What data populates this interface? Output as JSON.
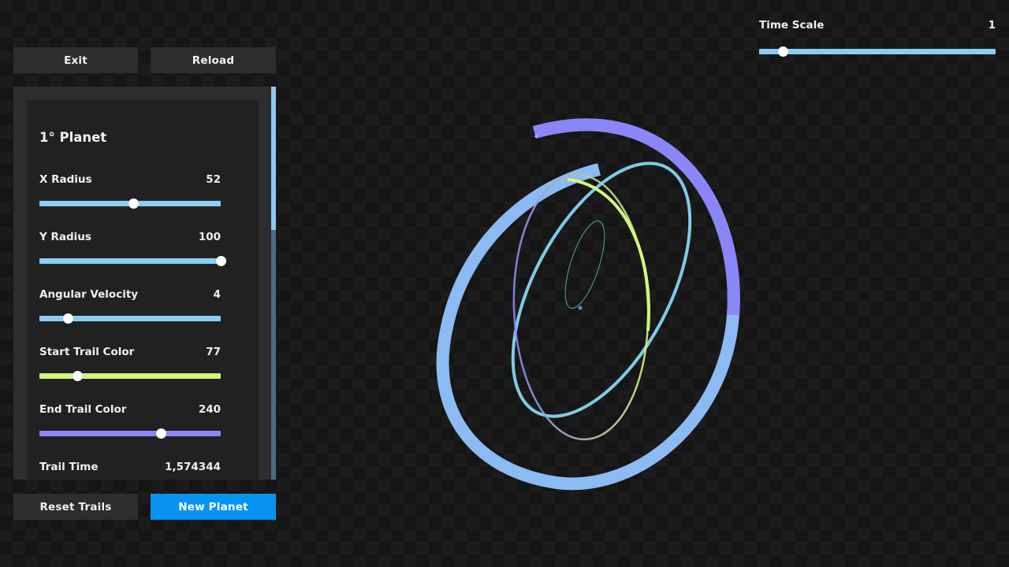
{
  "buttons": {
    "exit": "Exit",
    "reload": "Reload",
    "reset_trails": "Reset Trails",
    "new_planet": "New Planet"
  },
  "panel": {
    "title": "1° Planet",
    "fields": [
      {
        "label": "X Radius",
        "value": "52",
        "level": 0.52,
        "color": "#8ccdf5"
      },
      {
        "label": "Y Radius",
        "value": "100",
        "level": 1.0,
        "color": "#8ccdf5"
      },
      {
        "label": "Angular Velocity",
        "value": "4",
        "level": 0.16,
        "color": "#8ccdf5"
      },
      {
        "label": "Start Trail Color",
        "value": "77",
        "level": 0.21,
        "color": "#d1f77a"
      },
      {
        "label": "End Trail Color",
        "value": "240",
        "level": 0.67,
        "color": "#8a86f7"
      },
      {
        "label": "Trail Time",
        "value": "1,574344"
      }
    ],
    "scroll_fraction": 0.36
  },
  "time_scale": {
    "label": "Time Scale",
    "value": "1",
    "level": 0.1,
    "color": "#8ccdf5"
  },
  "colors": {
    "accent": "#0895f2",
    "slider_blue": "#8ccdf5",
    "trail_start": "#d1f77a",
    "trail_end": "#8a86f7"
  },
  "icons": {
    "sun": "center-dot-icon"
  }
}
